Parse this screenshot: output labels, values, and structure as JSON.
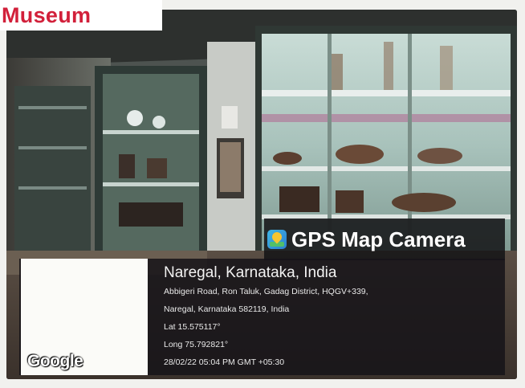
{
  "caption": {
    "text": "Museum",
    "color": "#d2203a"
  },
  "overlay": {
    "app_name": "GPS Map Camera",
    "app_icon": "gps-map-camera-app-icon",
    "map_brand": "Google",
    "location_title": "Naregal, Karnataka, India",
    "address_line_1": "Abbigeri Road, Ron Taluk, Gadag District, HQGV+339,",
    "address_line_2": "Naregal, Karnataka 582119, India",
    "latitude": "Lat 15.575117°",
    "longitude": "Long 75.792821°",
    "datetime": "28/02/22 05:04 PM GMT +05:30"
  },
  "scene": {
    "description_icon": "museum-shelves-photo"
  }
}
